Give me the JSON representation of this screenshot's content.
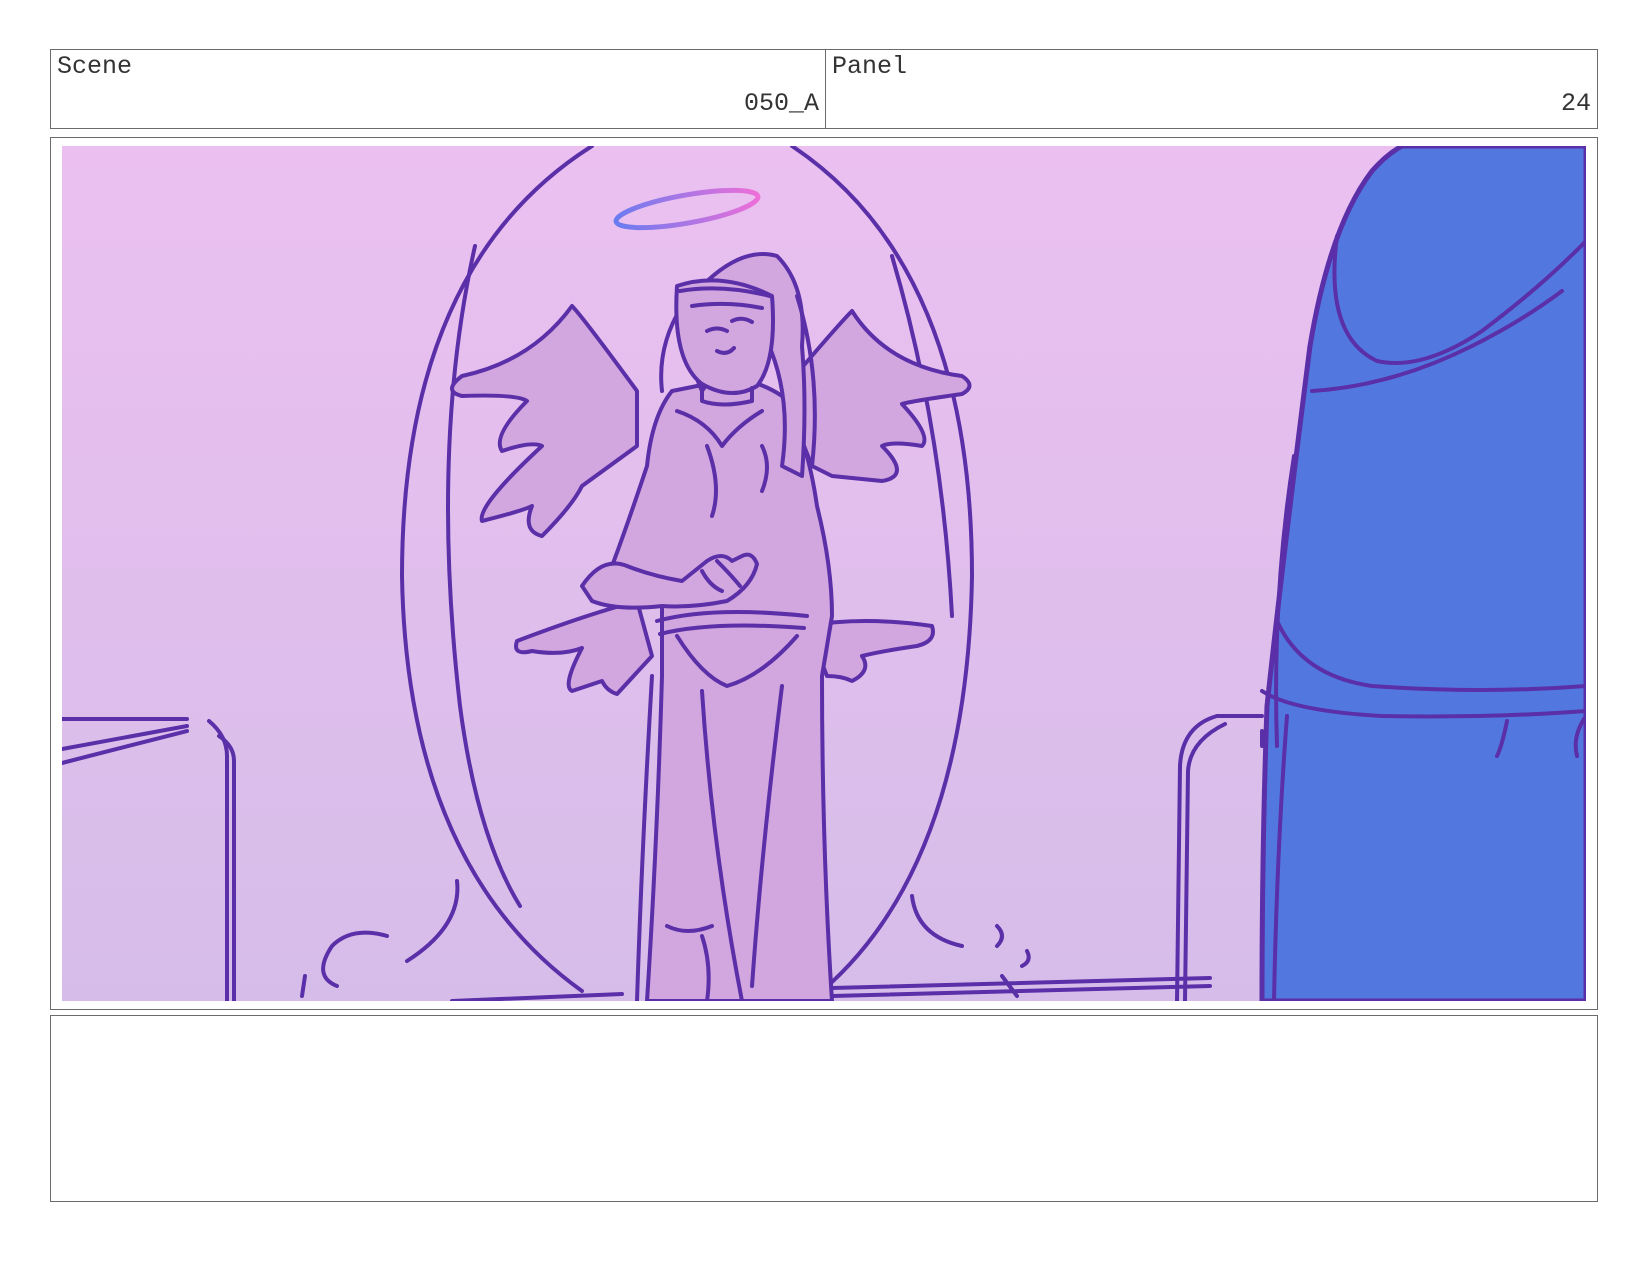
{
  "header": {
    "scene_label": "Scene",
    "scene_value": "050_A",
    "panel_label": "Panel",
    "panel_value": "24"
  },
  "artwork": {
    "bg_top": "#ebc0f0",
    "bg_bottom": "#d6bde9",
    "line_color": "#5a2fa8",
    "fill_color": "#d2a6de",
    "blue_figure": "#5278e0"
  },
  "notes": {
    "text": ""
  }
}
